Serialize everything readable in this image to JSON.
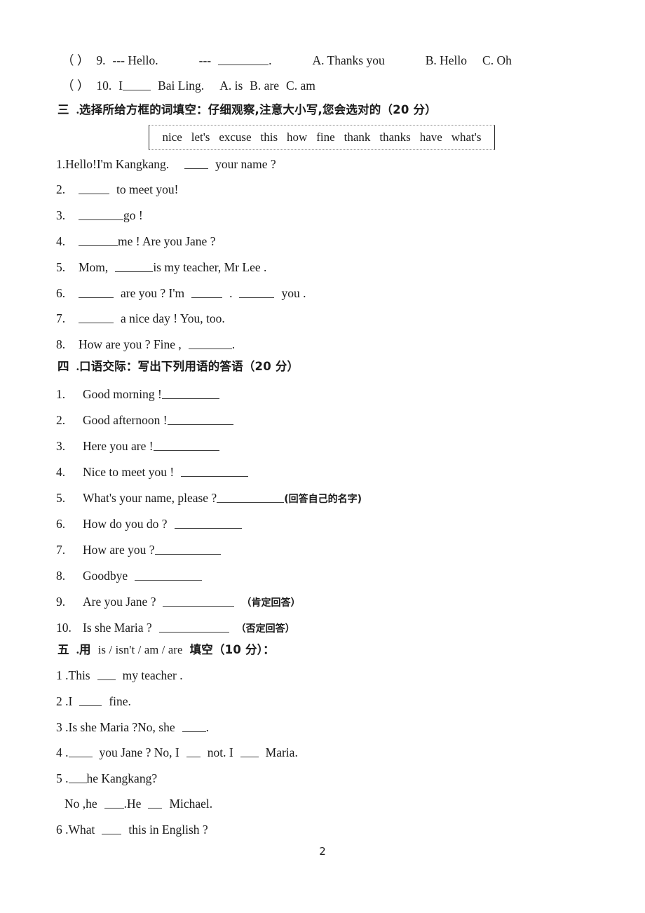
{
  "page": {
    "number": "2"
  },
  "mc_tail": [
    {
      "marker": "（  ）",
      "number": "9.",
      "stem_a": "--- Hello.",
      "stem_b": "---",
      "blank_after": ".",
      "options": [
        "A. Thanks you",
        "B. Hello",
        "C. Oh"
      ]
    },
    {
      "marker": "（  ）",
      "number": "10.",
      "stem_a": "I",
      "stem_b": "Bai Ling.",
      "options": [
        "A. is",
        "B. are",
        "C. am"
      ]
    }
  ],
  "section3": {
    "heading_cn": "三",
    "heading_dot": ".",
    "heading_text": "选择所给方框的词填空：仔细观察,注意大小写,您会选对的（20 分）",
    "wordbank": [
      "nice",
      "let's",
      "excuse",
      "this",
      "how",
      "fine",
      "thank",
      "thanks",
      "have",
      "what's"
    ],
    "items": [
      {
        "num": "1.",
        "before": "Hello!I'm Kangkang.",
        "after": "your name ?"
      },
      {
        "num": "2.",
        "before": "",
        "after": "to meet you!"
      },
      {
        "num": "3.",
        "before": "",
        "after": "go !"
      },
      {
        "num": "4.",
        "before": "",
        "after": "me ! Are you Jane ?"
      },
      {
        "num": "5.",
        "before": "Mom,",
        "after": "is my teacher, Mr Lee ."
      },
      {
        "num": "6.",
        "before": "",
        "mid1": "are you ? I'm",
        "mid2": ".",
        "after": "you ."
      },
      {
        "num": "7.",
        "before": "",
        "after": "a nice day ! You, too."
      },
      {
        "num": "8.",
        "before": "How are you ? Fine ,",
        "after": "."
      }
    ]
  },
  "section4": {
    "heading_cn": "四",
    "heading_dot": ".",
    "heading_text": "口语交际：写出下列用语的答语（20 分）",
    "items": [
      {
        "num": "1.",
        "text": "Good morning !",
        "note": ""
      },
      {
        "num": "2.",
        "text": "Good afternoon !",
        "note": ""
      },
      {
        "num": "3.",
        "text": "Here you are !",
        "note": ""
      },
      {
        "num": "4.",
        "text": "Nice to meet you !",
        "note": ""
      },
      {
        "num": "5.",
        "text": "What's your name, please ?",
        "note": "(回答自己的名字)"
      },
      {
        "num": "6.",
        "text": "How do you do ?",
        "note": ""
      },
      {
        "num": "7.",
        "text": "How are you ?",
        "note": ""
      },
      {
        "num": "8.",
        "text": "Goodbye",
        "note": ""
      },
      {
        "num": "9.",
        "text": "Are you Jane ?",
        "note": "（肯定回答）"
      },
      {
        "num": "10.",
        "text": "Is she Maria ?",
        "note": "（否定回答）"
      }
    ]
  },
  "section5": {
    "heading_cn": "五",
    "heading_dot": ".",
    "heading_用": "用",
    "heading_forms": "is / isn't / am / are",
    "heading_tail": "填空（10 分）：",
    "items": [
      {
        "num": "1 .",
        "a": "This",
        "b": "my teacher ."
      },
      {
        "num": "2 .",
        "a": "I",
        "b": "fine."
      },
      {
        "num": "3 .",
        "a": "Is she Maria ?No, she",
        "b": "."
      },
      {
        "num": "4 .",
        "a": "",
        "b": "you Jane ? No, I",
        "c": "not. I",
        "d": "Maria."
      },
      {
        "num": "5 .",
        "a": "",
        "b": "he Kangkang?"
      },
      {
        "num": "5b",
        "a": "No ,he",
        "b": ".He",
        "c": "Michael."
      },
      {
        "num": "6 .",
        "a": "What",
        "b": "this in English ?"
      }
    ]
  }
}
